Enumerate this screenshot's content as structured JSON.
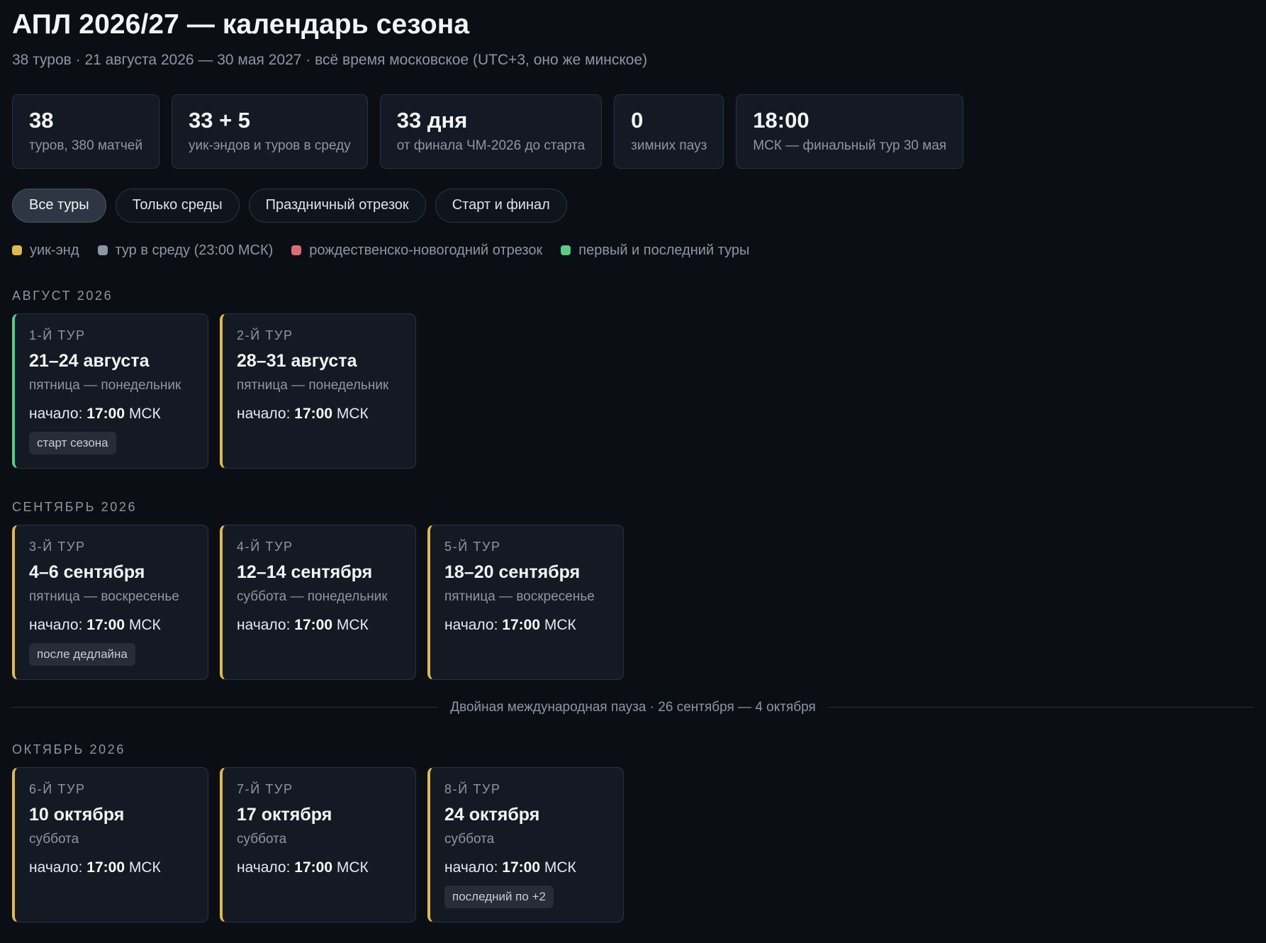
{
  "header": {
    "title": "АПЛ 2026/27 — календарь сезона",
    "subtitle": "38 туров · 21 августа 2026 — 30 мая 2027 · всё время московское (UTC+3, оно же минское)"
  },
  "stats": [
    {
      "value": "38",
      "label": "туров, 380 матчей"
    },
    {
      "value": "33 + 5",
      "label": "уик-эндов и туров в среду"
    },
    {
      "value": "33 дня",
      "label": "от финала ЧМ-2026 до старта"
    },
    {
      "value": "0",
      "label": "зимних пауз"
    },
    {
      "value": "18:00",
      "label": "МСК — финальный тур 30 мая"
    }
  ],
  "filters": [
    {
      "label": "Все туры",
      "active": true
    },
    {
      "label": "Только среды",
      "active": false
    },
    {
      "label": "Праздничный отрезок",
      "active": false
    },
    {
      "label": "Старт и финал",
      "active": false
    }
  ],
  "legend": [
    {
      "label": "уик-энд",
      "color": "#e0b84f"
    },
    {
      "label": "тур в среду (23:00 МСК)",
      "color": "#8c98a4"
    },
    {
      "label": "рождественско-новогодний отрезок",
      "color": "#e06b78"
    },
    {
      "label": "первый и последний туры",
      "color": "#5ccb86"
    }
  ],
  "time_prefix": "начало:",
  "time_suffix": "МСК",
  "months": [
    {
      "title": "Август 2026",
      "rounds": [
        {
          "round": "1-й тур",
          "dates": "21–24 августа",
          "days": "пятница — понедельник",
          "time": "17:00",
          "tag": "старт сезона",
          "accent": "#5ccb86"
        },
        {
          "round": "2-й тур",
          "dates": "28–31 августа",
          "days": "пятница — понедельник",
          "time": "17:00",
          "tag": "",
          "accent": "#e0b84f"
        }
      ]
    },
    {
      "title": "Сентябрь 2026",
      "rounds": [
        {
          "round": "3-й тур",
          "dates": "4–6 сентября",
          "days": "пятница — воскресенье",
          "time": "17:00",
          "tag": "после дедлайна",
          "accent": "#e0b84f"
        },
        {
          "round": "4-й тур",
          "dates": "12–14 сентября",
          "days": "суббота — понедельник",
          "time": "17:00",
          "tag": "",
          "accent": "#e0b84f"
        },
        {
          "round": "5-й тур",
          "dates": "18–20 сентября",
          "days": "пятница — воскресенье",
          "time": "17:00",
          "tag": "",
          "accent": "#e0b84f"
        }
      ]
    },
    {
      "title": "Октябрь 2026",
      "rounds": [
        {
          "round": "6-й тур",
          "dates": "10 октября",
          "days": "суббота",
          "time": "17:00",
          "tag": "",
          "accent": "#e0b84f"
        },
        {
          "round": "7-й тур",
          "dates": "17 октября",
          "days": "суббота",
          "time": "17:00",
          "tag": "",
          "accent": "#e0b84f"
        },
        {
          "round": "8-й тур",
          "dates": "24 октября",
          "days": "суббота",
          "time": "17:00",
          "tag": "последний по +2",
          "accent": "#e0b84f"
        }
      ]
    }
  ],
  "pause": {
    "text": "Двойная международная пауза · 26 сентября — 4 октября"
  }
}
